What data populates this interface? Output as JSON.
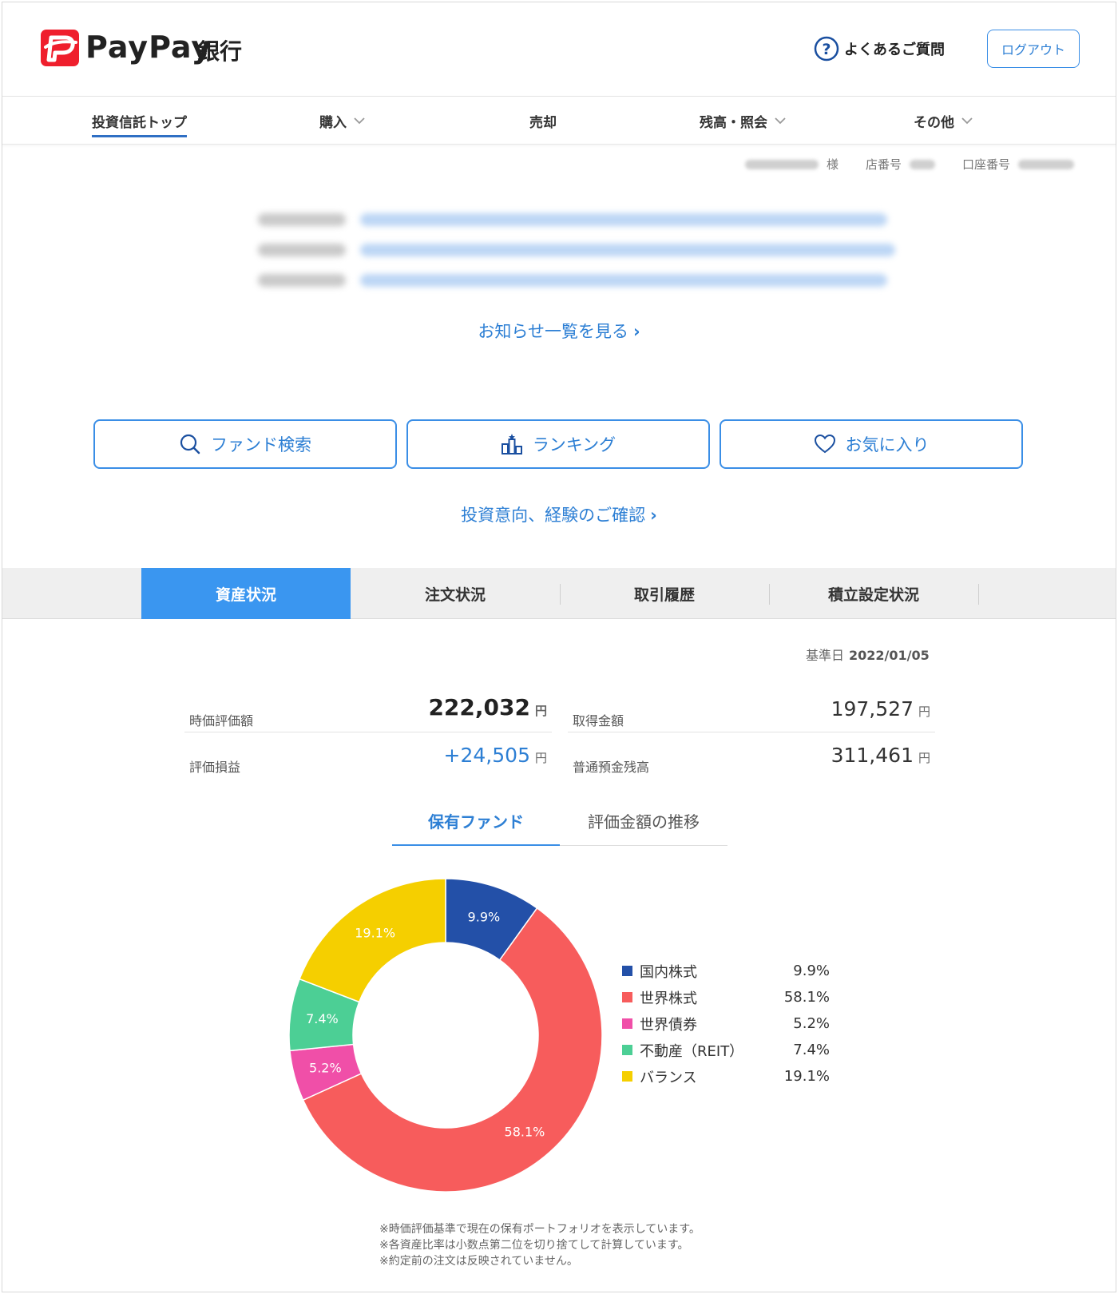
{
  "header": {
    "logo_text": "PayPay",
    "logo_bank": "銀行",
    "faq_label": "よくあるご質問",
    "logout_label": "ログアウト"
  },
  "gnav": {
    "items": [
      {
        "label": "投資信託トップ"
      },
      {
        "label": "購入"
      },
      {
        "label": "売却"
      },
      {
        "label": "残高・照会"
      },
      {
        "label": "その他"
      }
    ]
  },
  "userinfo": {
    "honorific": "様",
    "branch_label": "店番号",
    "account_label": "口座番号"
  },
  "news": {
    "more_label": "お知らせ一覧を見る"
  },
  "actions": {
    "fund_search": "ファンド検索",
    "ranking": "ランキング",
    "favorites": "お気に入り",
    "intent_link": "投資意向、経験のご確認"
  },
  "tabs": [
    {
      "label": "資産状況"
    },
    {
      "label": "注文状況"
    },
    {
      "label": "取引履歴"
    },
    {
      "label": "積立設定状況"
    }
  ],
  "summary": {
    "base_date_label": "基準日",
    "base_date": "2022/01/05",
    "market_value_label": "時価評価額",
    "market_value": "222,032",
    "acquisition_label": "取得金額",
    "acquisition": "197,527",
    "pl_label": "評価損益",
    "pl": "+24,505",
    "deposit_label": "普通預金残高",
    "deposit": "311,461",
    "yen": "円"
  },
  "subtabs": [
    {
      "label": "保有ファンド"
    },
    {
      "label": "評価金額の推移"
    }
  ],
  "chart_data": {
    "type": "pie",
    "categories": [
      "国内株式",
      "世界株式",
      "世界債券",
      "不動産（REIT）",
      "バランス"
    ],
    "values": [
      9.9,
      58.1,
      5.2,
      7.4,
      19.1
    ],
    "labels": [
      "9.9%",
      "58.1%",
      "5.2%",
      "7.4%",
      "19.1%"
    ],
    "colors": [
      "#2350a8",
      "#f75c5c",
      "#f04fa8",
      "#4ccf95",
      "#f5cf00"
    ],
    "donut": true
  },
  "notes": [
    "※時価評価基準で現在の保有ポートフォリオを表示しています。",
    "※各資産比率は小数点第二位を切り捨てして計算しています。",
    "※約定前の注文は反映されていません。"
  ],
  "colors": {
    "accent": "#3a8ee6",
    "active_tab": "#3a96f0",
    "brand_red": "#ef1f2d"
  }
}
